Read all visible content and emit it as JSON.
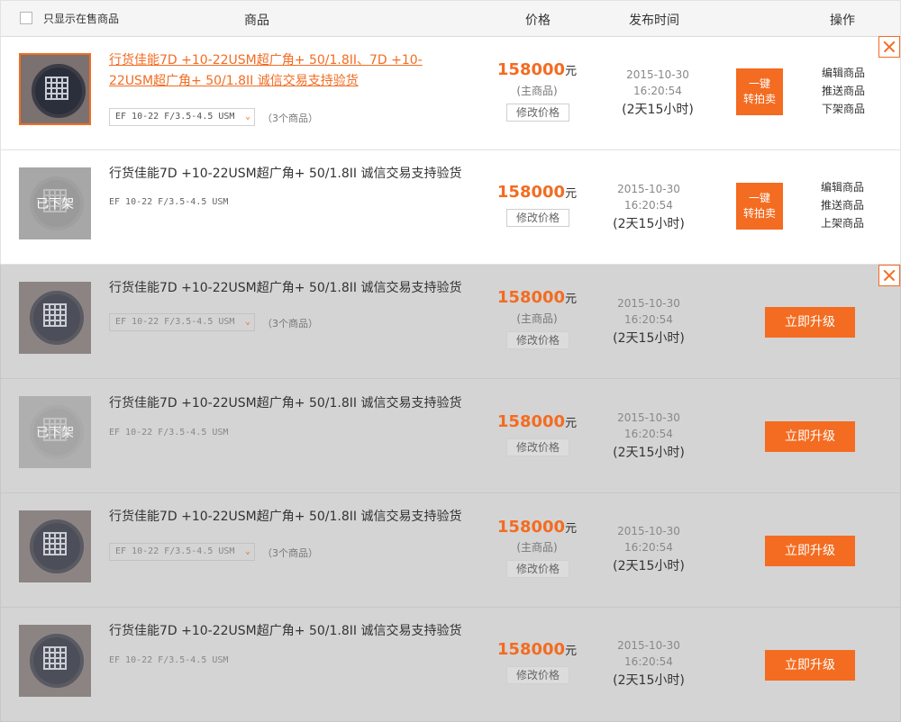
{
  "header": {
    "only_on_sale": "只显示在售商品",
    "col_product": "商品",
    "col_price": "价格",
    "col_publish_time": "发布时间",
    "col_actions": "操作"
  },
  "rows": [
    {
      "title": "行货佳能7D +10-22USM超广角+ 50/1.8II、7D +10-22USM超广角+ 50/1.8II 诚信交易支持验货",
      "spec": "EF 10-22 F/3.5-4.5 USM",
      "count": "（3个商品）",
      "price": "158000",
      "unit": "元",
      "main_label": "(主商品)",
      "edit_price": "修改价格",
      "date": "2015-10-30",
      "time": "16:20:54",
      "duration": "(2天15小时)",
      "onekey_line1": "一键",
      "onekey_line2": "转拍卖",
      "op1": "编辑商品",
      "op2": "推送商品",
      "op3": "下架商品"
    },
    {
      "title": "行货佳能7D +10-22USM超广角+ 50/1.8II 诚信交易支持验货",
      "spec": "EF 10-22 F/3.5-4.5 USM",
      "offline": "已下架",
      "price": "158000",
      "unit": "元",
      "edit_price": "修改价格",
      "date": "2015-10-30",
      "time": "16:20:54",
      "duration": "(2天15小时)",
      "onekey_line1": "一键",
      "onekey_line2": "转拍卖",
      "op1": "编辑商品",
      "op2": "推送商品",
      "op3": "上架商品"
    },
    {
      "title": "行货佳能7D +10-22USM超广角+ 50/1.8II 诚信交易支持验货",
      "spec": "EF 10-22 F/3.5-4.5 USM",
      "count": "（3个商品）",
      "price": "158000",
      "unit": "元",
      "main_label": "(主商品)",
      "edit_price": "修改价格",
      "date": "2015-10-30",
      "time": "16:20:54",
      "duration": "(2天15小时)",
      "upgrade": "立即升级"
    },
    {
      "title": "行货佳能7D +10-22USM超广角+ 50/1.8II 诚信交易支持验货",
      "spec": "EF 10-22 F/3.5-4.5 USM",
      "offline": "已下架",
      "price": "158000",
      "unit": "元",
      "edit_price": "修改价格",
      "date": "2015-10-30",
      "time": "16:20:54",
      "duration": "(2天15小时)",
      "upgrade": "立即升级"
    },
    {
      "title": "行货佳能7D +10-22USM超广角+ 50/1.8II 诚信交易支持验货",
      "spec": "EF 10-22 F/3.5-4.5 USM",
      "count": "（3个商品）",
      "price": "158000",
      "unit": "元",
      "main_label": "(主商品)",
      "edit_price": "修改价格",
      "date": "2015-10-30",
      "time": "16:20:54",
      "duration": "(2天15小时)",
      "upgrade": "立即升级"
    },
    {
      "title": "行货佳能7D +10-22USM超广角+ 50/1.8II 诚信交易支持验货",
      "spec": "EF 10-22 F/3.5-4.5 USM",
      "price": "158000",
      "unit": "元",
      "edit_price": "修改价格",
      "date": "2015-10-30",
      "time": "16:20:54",
      "duration": "(2天15小时)",
      "upgrade": "立即升级"
    }
  ],
  "colors": {
    "accent": "#f36c21",
    "row_gray": "#d4d4d4",
    "header_bg": "#f5f5f5"
  },
  "icons": {
    "close": "close-icon",
    "dropdown": "chevron-down-icon",
    "checkbox": "checkbox-icon"
  }
}
